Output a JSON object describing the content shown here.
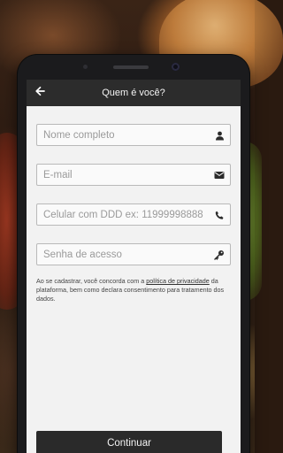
{
  "header": {
    "title": "Quem é você?"
  },
  "form": {
    "name_placeholder": "Nome completo",
    "email_placeholder": "E-mail",
    "phone_placeholder": "Celular com DDD ex: 11999998888",
    "password_placeholder": "Senha de acesso"
  },
  "terms": {
    "prefix": "Ao se cadastrar, você concorda com a ",
    "link": "política de privacidade",
    "suffix": " da plataforma, bem como declara consentimento para tratamento dos dados."
  },
  "actions": {
    "continue_label": "Continuar"
  },
  "colors": {
    "appbar": "#2c2c2c",
    "screen_bg": "#f2f2f2",
    "button": "#2a2a2a"
  },
  "icons": {
    "back": "arrow-left-icon",
    "name": "user-icon",
    "email": "envelope-icon",
    "phone": "phone-icon",
    "password": "key-icon"
  }
}
